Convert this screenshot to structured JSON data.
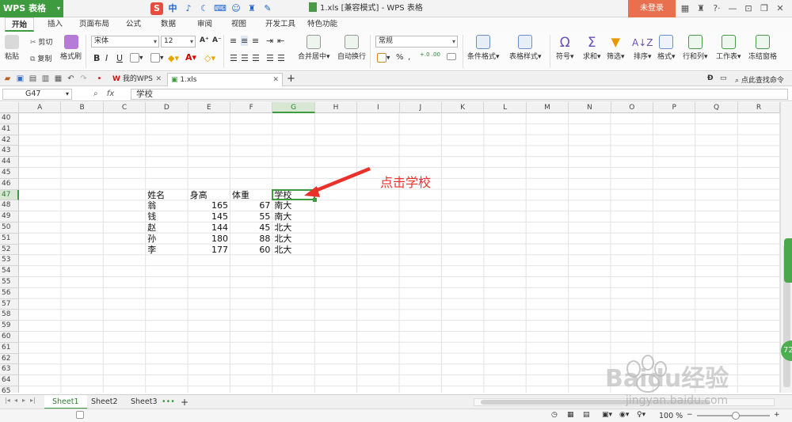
{
  "titlebar": {
    "app_button": "WPS 表格",
    "ime_icons": [
      "中",
      "♪",
      "☾",
      "⌨",
      "☺",
      "♜",
      "✎"
    ],
    "doc_title": "1.xls [兼容模式] - WPS 表格",
    "login": "未登录",
    "window_controls": [
      "▦",
      "♜",
      "?·",
      "—",
      "⊡",
      "❐",
      "✕"
    ]
  },
  "ribbon_tabs": [
    "开始",
    "插入",
    "页面布局",
    "公式",
    "数据",
    "审阅",
    "视图",
    "开发工具",
    "特色功能"
  ],
  "ribbon": {
    "paste": "粘贴",
    "cut": "剪切",
    "copy": "复制",
    "format_painter": "格式刷",
    "font_name": "宋体",
    "font_size": "12",
    "font_grow": "A⁺",
    "font_shrink": "A⁻",
    "bold": "B",
    "italic": "I",
    "underline": "U",
    "merge_center": "合并居中",
    "wrap_text": "自动换行",
    "number_format": "常规",
    "percent": "%",
    "comma": "‚",
    "dec_inc": "+.0 .00",
    "dec_dec": "-.0 .00",
    "conditional_format": "条件格式",
    "table_style": "表格样式",
    "symbol": "符号",
    "sum": "求和",
    "filter": "筛选",
    "sort": "排序",
    "format": "格式",
    "row_col": "行和列",
    "worksheet": "工作表",
    "freeze": "冻结窗格"
  },
  "docbar": {
    "tabs": [
      {
        "label": "我的WPS",
        "active": false
      },
      {
        "label": "1.xls",
        "active": true
      }
    ],
    "add": "+",
    "search": "点此查找命令"
  },
  "formula_bar": {
    "name_box": "G47",
    "fx": "fx",
    "value": "学校"
  },
  "grid": {
    "columns": [
      "A",
      "B",
      "C",
      "D",
      "E",
      "F",
      "G",
      "H",
      "I",
      "J",
      "K",
      "L",
      "M",
      "N",
      "O",
      "P",
      "Q",
      "R"
    ],
    "selected_column": "G",
    "rows": [
      "40",
      "41",
      "42",
      "43",
      "44",
      "45",
      "46",
      "47",
      "48",
      "49",
      "50",
      "51",
      "52",
      "53",
      "54",
      "55",
      "56",
      "57",
      "58",
      "59",
      "60",
      "61",
      "62",
      "63",
      "64",
      "65"
    ],
    "selected_row": "47",
    "table": {
      "headers": [
        "姓名",
        "身高",
        "体重",
        "学校"
      ],
      "rows": [
        [
          "翁",
          "165",
          "67",
          "南大"
        ],
        [
          "钱",
          "145",
          "55",
          "南大"
        ],
        [
          "赵",
          "144",
          "45",
          "北大"
        ],
        [
          "孙",
          "180",
          "88",
          "北大"
        ],
        [
          "李",
          "177",
          "60",
          "北大"
        ]
      ]
    }
  },
  "annotation": "点击学校",
  "sheets": {
    "tabs": [
      "Sheet1",
      "Sheet2",
      "Sheet3"
    ],
    "active": "Sheet1",
    "more": "•••",
    "add": "+"
  },
  "statusbar": {
    "zoom": "100 %"
  },
  "side_badge": "72",
  "watermark": {
    "logo": "Baidu经验",
    "url": "jingyan.baidu.com"
  },
  "colors": {
    "accent": "#3f9b3f",
    "login_bg": "#e8704f",
    "annotation": "#e8312b"
  }
}
